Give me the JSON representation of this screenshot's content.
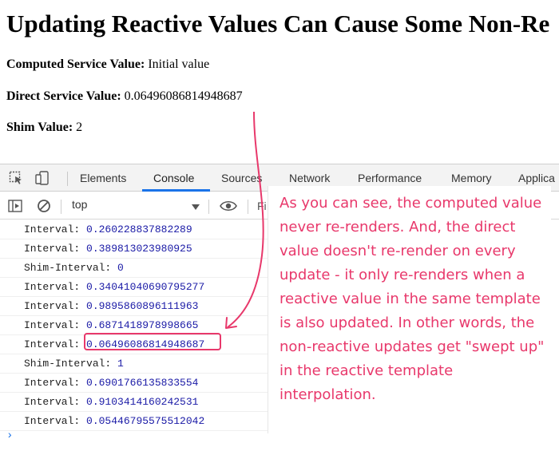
{
  "page": {
    "title": "Updating Reactive Values Can Cause Some Non-Re",
    "computed_label": "Computed Service Value:",
    "computed_value": "Initial value",
    "direct_label": "Direct Service Value:",
    "direct_value": "0.06496086814948687",
    "shim_label": "Shim Value:",
    "shim_value": "2"
  },
  "devtools": {
    "tabs": [
      "Elements",
      "Console",
      "Sources",
      "Network",
      "Performance",
      "Memory",
      "Applica"
    ],
    "active_tab": "Console",
    "context": "top",
    "filter_partial": "Fi",
    "logs": [
      {
        "label": "Interval:",
        "value": "0.260228837882289"
      },
      {
        "label": "Interval:",
        "value": "0.389813023980925"
      },
      {
        "label": "Shim-Interval:",
        "value": "0"
      },
      {
        "label": "Interval:",
        "value": "0.34041040690795277"
      },
      {
        "label": "Interval:",
        "value": "0.9895860896111963"
      },
      {
        "label": "Interval:",
        "value": "0.6871418978998665"
      },
      {
        "label": "Interval:",
        "value": "0.06496086814948687"
      },
      {
        "label": "Shim-Interval:",
        "value": "1"
      },
      {
        "label": "Interval:",
        "value": "0.6901766135833554"
      },
      {
        "label": "Interval:",
        "value": "0.9103414160242531"
      },
      {
        "label": "Interval:",
        "value": "0.05446795575512042"
      }
    ],
    "prompt_symbol": "›"
  },
  "annotation": {
    "text": "As you can see, the computed value never re-renders. And, the direct value doesn't re-render on every update - it only re-renders when a reactive value in the same template is also updated. In other words, the non-reactive updates get \"swept up\" in the reactive template interpolation.",
    "color": "#e8386b"
  },
  "colors": {
    "accent": "#1a73e8",
    "log_number": "#1a1aa6",
    "annotation": "#e8386b"
  }
}
